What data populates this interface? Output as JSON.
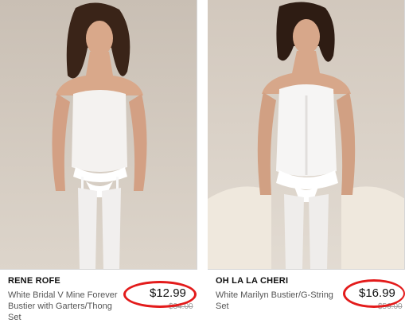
{
  "products": [
    {
      "brand": "RENE ROFE",
      "title": "White Bridal V Mine Forever Bustier with Garters/Thong Set",
      "price": "$12.99",
      "original_price": "$34.00"
    },
    {
      "brand": "OH LA LA CHERI",
      "title": "White Marilyn Bustier/G-String Set",
      "price": "$16.99",
      "original_price": "$56.00"
    }
  ],
  "colors": {
    "highlight_circle": "#e31b1b",
    "price_text": "#111111",
    "old_price_text": "#9a9a9a",
    "title_text": "#555555"
  }
}
